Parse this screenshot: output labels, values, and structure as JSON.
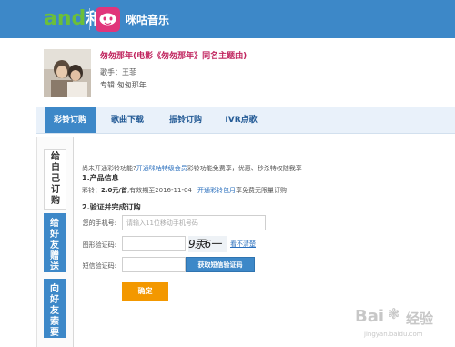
{
  "header": {
    "logo_a": "and",
    "logo_b": "和",
    "brand": "咪咕音乐"
  },
  "song": {
    "title": "匆匆那年(电影《匆匆那年》同名主题曲)",
    "singer": "歌手：王菲",
    "album": "专辑:匆匆那年"
  },
  "tabs": [
    {
      "label": "彩铃订购"
    },
    {
      "label": "歌曲下载"
    },
    {
      "label": "振铃订购"
    },
    {
      "label": "IVR点歌"
    }
  ],
  "side_tabs": [
    {
      "label": "给自己订购",
      "chars": [
        "给",
        "自",
        "己",
        "订",
        "购"
      ]
    },
    {
      "label": "给好友赠送",
      "chars": [
        "给",
        "好",
        "友",
        "赠",
        "送"
      ]
    },
    {
      "label": "向好友索要",
      "chars": [
        "向",
        "好",
        "友",
        "索",
        "要"
      ]
    }
  ],
  "order": {
    "notice_prefix": "尚未开通彩铃功能?",
    "notice_link": "开通咪咕特级会员",
    "notice_suffix": "彩铃功能免费享，优惠、秒杀特权随我享",
    "section1": "1.产品信息",
    "price_label": "彩铃：",
    "price_value": "2.0元/首",
    "price_expire": ",有效期至2016-11-04",
    "package_link": "开通彩铃包月",
    "package_suffix": "享免费无限量订购",
    "section2": "2.验证并完成订购",
    "phone_label": "您的手机号:",
    "phone_placeholder": "请输入11位移动手机号码",
    "img_code_label": "图形验证码:",
    "captcha_text": "9汞6一",
    "refresh_link": "看不清楚",
    "sms_code_label": "短信验证码:",
    "sms_button": "获取短信验证码",
    "confirm_button": "确定"
  },
  "watermark": {
    "text": "Bai",
    "text2": "经验",
    "sub": "jingyan.baidu.com"
  },
  "colors": {
    "header_blue": "#3d88c8",
    "title_red": "#c0255f",
    "link_blue": "#2a6fbd",
    "confirm_orange": "#f39800"
  }
}
